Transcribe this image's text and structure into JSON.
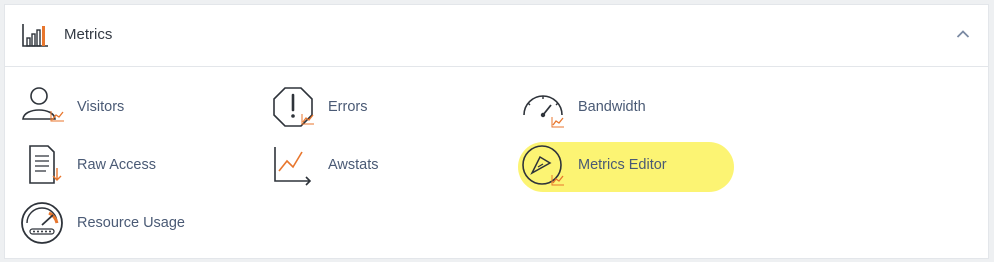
{
  "section": {
    "title": "Metrics",
    "collapse_icon": "chevron-up-icon",
    "icon": "bar-chart-icon"
  },
  "items": [
    {
      "label": "Visitors",
      "icon": "visitors-icon"
    },
    {
      "label": "Errors",
      "icon": "errors-icon"
    },
    {
      "label": "Bandwidth",
      "icon": "bandwidth-icon"
    },
    {
      "label": "Raw Access",
      "icon": "raw-access-icon"
    },
    {
      "label": "Awstats",
      "icon": "awstats-icon"
    },
    {
      "label": "Metrics Editor",
      "icon": "metrics-editor-icon",
      "highlighted": true
    },
    {
      "label": "Resource Usage",
      "icon": "resource-usage-icon"
    }
  ],
  "colors": {
    "accent_orange": "#e8762d",
    "icon_dark": "#2e333a",
    "label_blue": "#4a5a75",
    "highlight": "#fbf25a"
  }
}
